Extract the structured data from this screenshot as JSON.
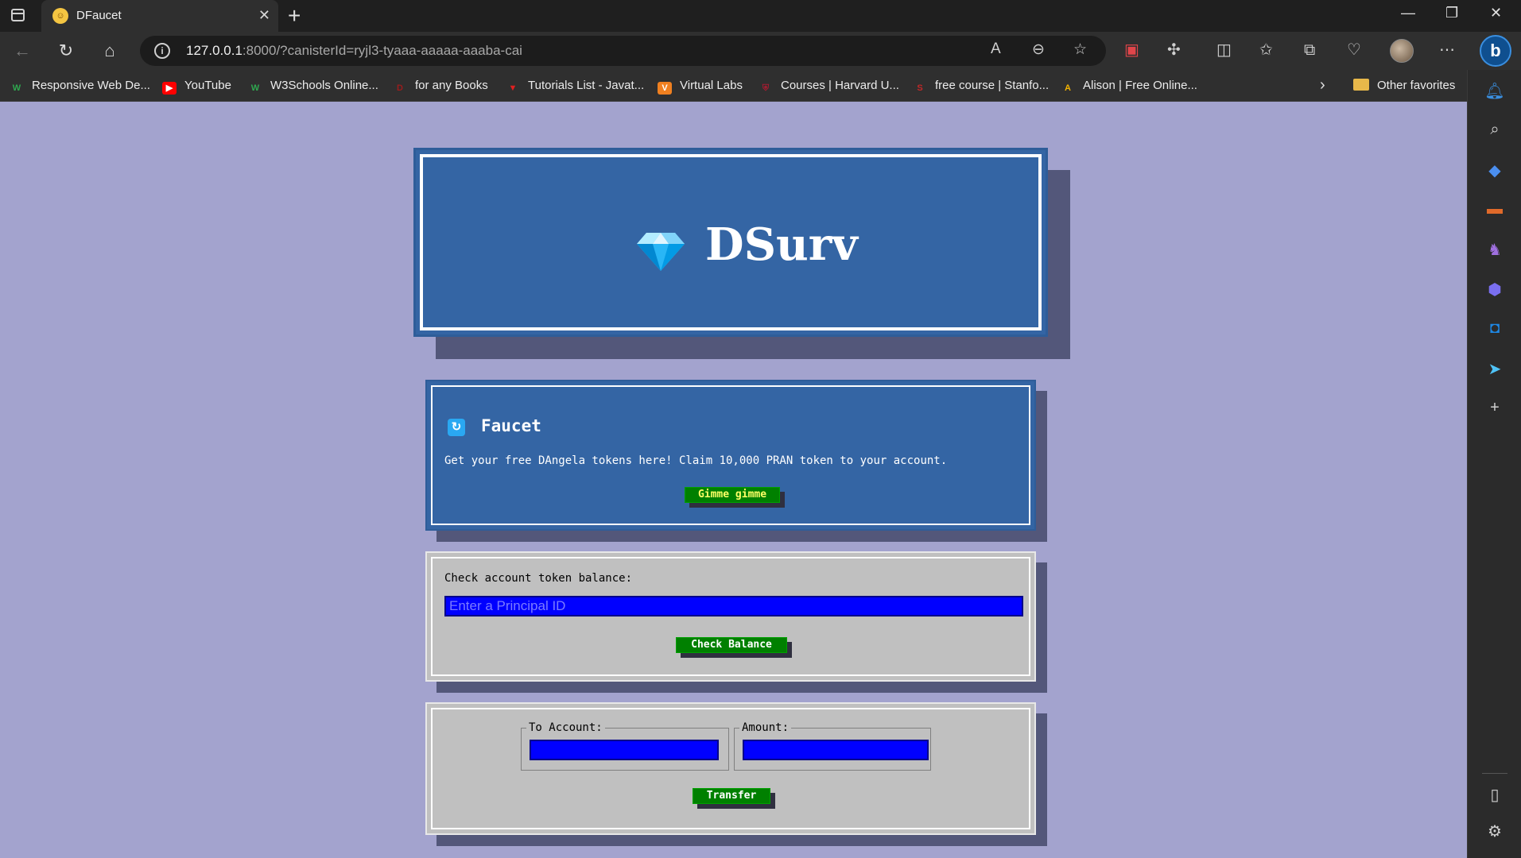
{
  "browser": {
    "tab_title": "DFaucet",
    "url_host": "127.0.0.1",
    "url_rest": ":8000/?canisterId=ryjl3-tyaaa-aaaaa-aaaba-cai",
    "bookmarks": [
      {
        "label": "Responsive Web De...",
        "icon_color": "#2fa84f"
      },
      {
        "label": "YouTube",
        "icon_color": "#ff0000"
      },
      {
        "label": "W3Schools Online...",
        "icon_color": "#2fa84f"
      },
      {
        "label": "for any Books",
        "icon_color": "#9b1c1c"
      },
      {
        "label": "Tutorials List - Javat...",
        "icon_color": "#e02020"
      },
      {
        "label": "Virtual Labs",
        "icon_color": "#f08020"
      },
      {
        "label": "Courses | Harvard U...",
        "icon_color": "#a51c30"
      },
      {
        "label": "free course | Stanfo...",
        "icon_color": "#8c1515"
      },
      {
        "label": "Alison | Free Online...",
        "icon_color": "#f4b400"
      }
    ],
    "other_favorites": "Other favorites"
  },
  "app": {
    "brand": "DSurv",
    "faucet": {
      "title": "Faucet",
      "description": "Get your free DAngela tokens here! Claim 10,000 PRAN token to your account.",
      "button": "Gimme gimme"
    },
    "balance": {
      "label": "Check account token balance:",
      "placeholder": "Enter a Principal ID",
      "button": "Check Balance"
    },
    "transfer": {
      "to_label": "To Account:",
      "amount_label": "Amount:",
      "button": "Transfer"
    }
  },
  "colors": {
    "page_bg": "#a3a3ce",
    "card_blue": "#3465a4",
    "card_grey": "#c0c0c0",
    "button_green": "#008000",
    "input_blue": "#0000ff"
  }
}
